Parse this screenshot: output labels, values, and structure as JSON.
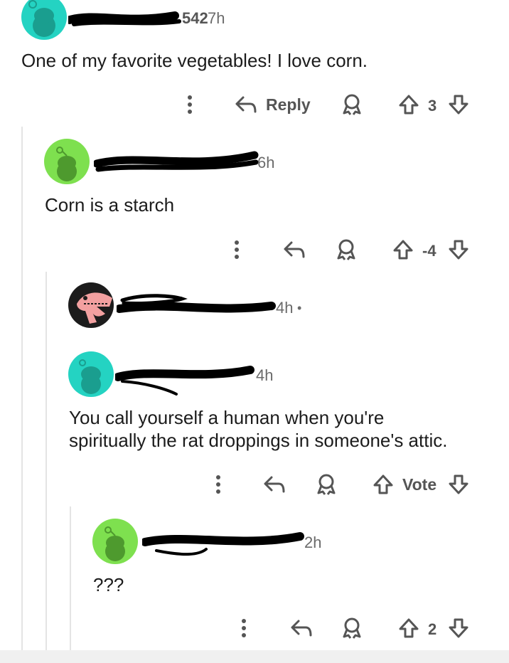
{
  "comments": [
    {
      "username": "",
      "username_tail": "542",
      "age": "7h",
      "body": "One of my favorite vegetables! I love corn.",
      "reply_label": "Reply",
      "score": "3",
      "avatar_color": "#24d3c2"
    },
    {
      "username": "",
      "age": "6h",
      "body": "Corn is a starch",
      "score": "-4",
      "avatar_color": "#7ee04f"
    },
    {
      "username": "",
      "age": "4h",
      "dot": "•",
      "body": "",
      "avatar_color": "#1c1c1c"
    },
    {
      "username": "",
      "age": "4h",
      "body_line1": "You call yourself a human when you're",
      "body_line2": "spiritually the rat droppings in someone's attic.",
      "vote_label": "Vote",
      "avatar_color": "#24d3c2"
    },
    {
      "username": "",
      "age": "2h",
      "body": "???",
      "score": "2",
      "avatar_color": "#7ee04f"
    }
  ],
  "icons": {
    "more": "more-options-icon",
    "reply": "reply-arrow-icon",
    "award": "award-icon",
    "upvote": "upvote-arrow-icon",
    "downvote": "downvote-arrow-icon"
  }
}
